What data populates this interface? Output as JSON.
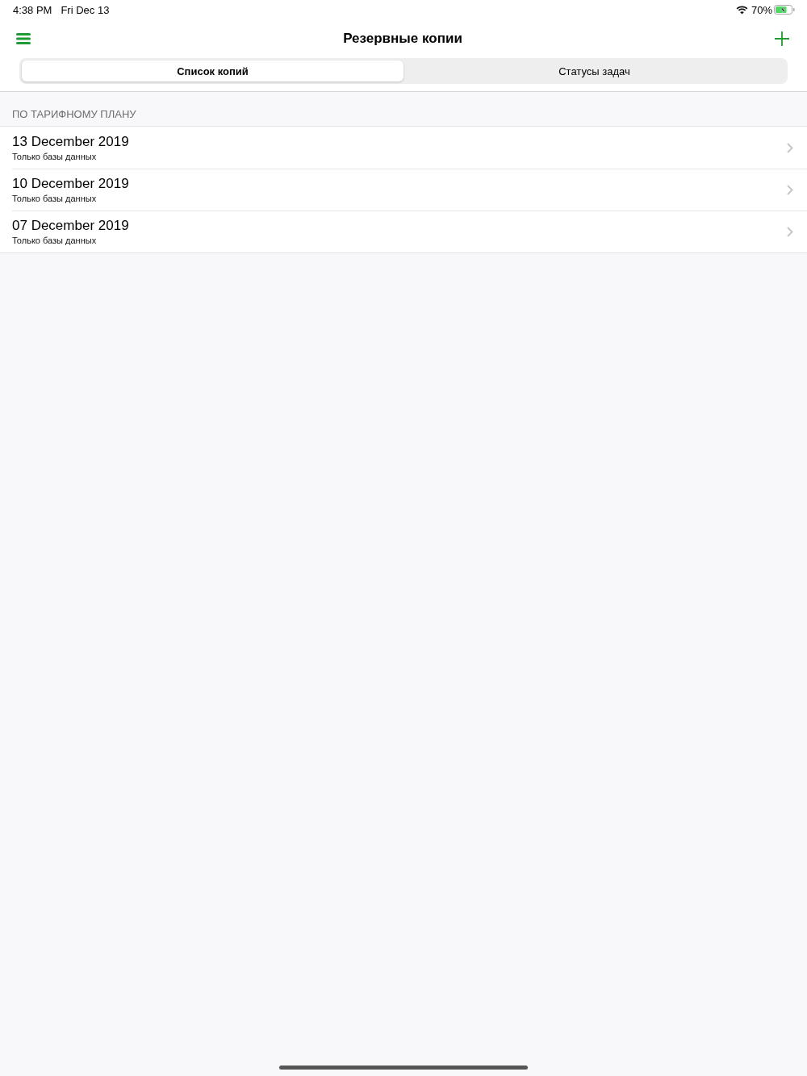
{
  "status_bar": {
    "time": "4:38 PM",
    "date": "Fri Dec 13",
    "battery_text": "70%",
    "charging": true
  },
  "nav_bar": {
    "title": "Резервные копии"
  },
  "tabs": [
    {
      "label": "Список копий",
      "selected": true
    },
    {
      "label": "Статусы задач",
      "selected": false
    }
  ],
  "section": {
    "header": "ПО ТАРИФНОМУ ПЛАНУ",
    "rows": [
      {
        "title": "13 December 2019",
        "subtitle": "Только базы данных"
      },
      {
        "title": "10 December 2019",
        "subtitle": "Только базы данных"
      },
      {
        "title": "07 December 2019",
        "subtitle": "Только базы данных"
      }
    ]
  }
}
